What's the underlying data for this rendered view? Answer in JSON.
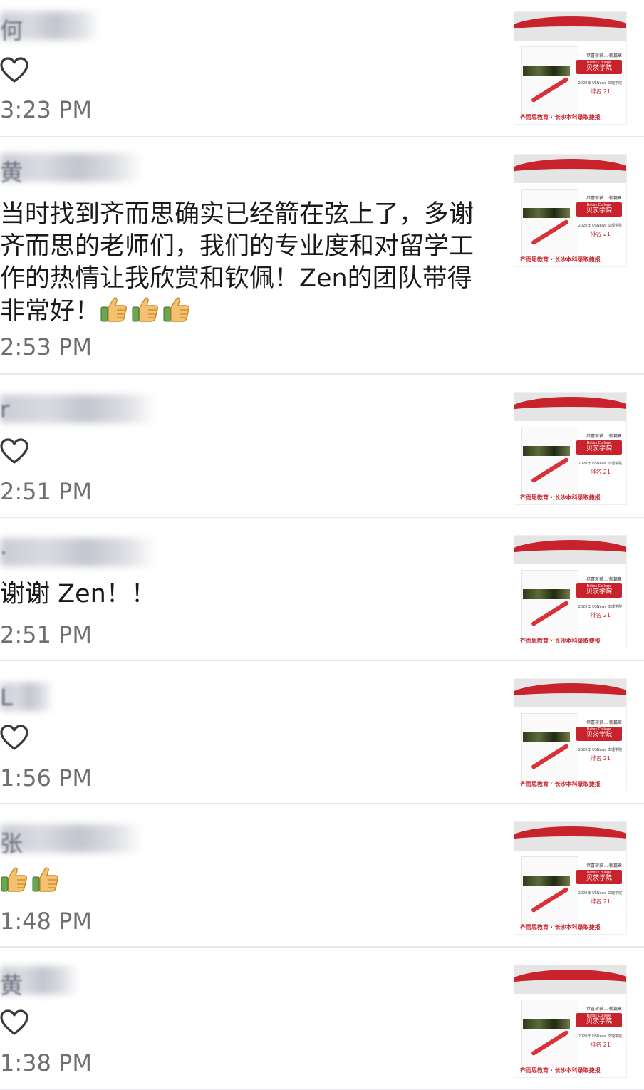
{
  "comments": [
    {
      "initial": "何",
      "name_blurred": "████",
      "message": "",
      "emoji_count": 0,
      "show_like": true,
      "time": "3:23 PM"
    },
    {
      "initial": "黄",
      "name_blurred": "████████",
      "message": "当时找到齐而思确实已经箭在弦上了，多谢齐而思的老师们，我们的专业度和对留学工作的热情让我欣赏和钦佩！Zen的团队带得非常好！",
      "emoji_count": 3,
      "show_like": false,
      "time": "2:53 PM"
    },
    {
      "initial": "r",
      "name_blurred": "████████",
      "message": "",
      "emoji_count": 0,
      "show_like": true,
      "time": "2:51 PM"
    },
    {
      "initial": "·",
      "name_blurred": "████████",
      "message": "谢谢 Zen！！",
      "emoji_count": 0,
      "show_like": false,
      "time": "2:51 PM"
    },
    {
      "initial": "L",
      "name_blurred": "███",
      "message": "",
      "emoji_count": 0,
      "show_like": true,
      "time": "1:56 PM"
    },
    {
      "initial": "张",
      "name_blurred": "████████",
      "message": "",
      "emoji_count": 2,
      "show_like": false,
      "time": "1:48 PM"
    },
    {
      "initial": "黄",
      "name_blurred": "████",
      "message": "",
      "emoji_count": 0,
      "show_like": true,
      "time": "1:38 PM"
    }
  ],
  "thumbnail": {
    "header_text": "恭喜斩获…·新篇章",
    "label_en": "Bates College",
    "label_cn": "贝茨学院",
    "rank_line": "2020年 USNews 文理学院",
    "rank_value": "排名 21",
    "footer_text": "齐而思教育 · 长沙本科录取捷报",
    "accent_color": "#c8232c"
  },
  "icons": {
    "like": "heart-outline-icon",
    "emoji": "thumbs-up-emoji"
  }
}
